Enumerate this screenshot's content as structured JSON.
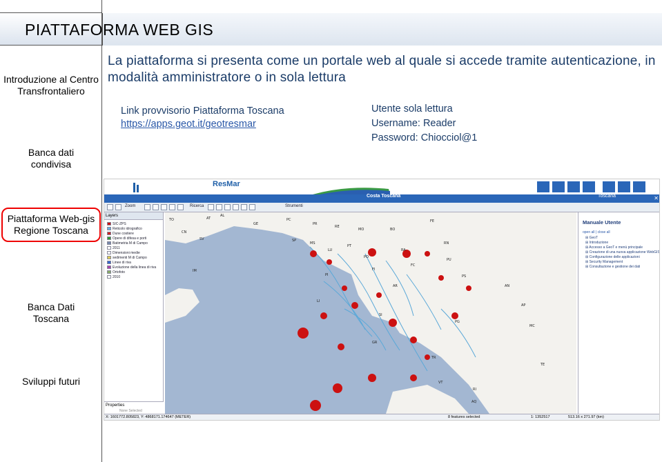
{
  "header": {
    "title": "PIATTAFORMA WEB GIS"
  },
  "nav": {
    "items": [
      {
        "label": "Introduzione al Centro Transfrontaliero",
        "active": false
      },
      {
        "label": "Banca dati condivisa",
        "active": false
      },
      {
        "label": "Piattaforma Web-gis Regione Toscana",
        "active": true
      },
      {
        "label": "Banca Dati Toscana",
        "active": false
      },
      {
        "label": "Sviluppi futuri",
        "active": false
      }
    ]
  },
  "content": {
    "intro": "La piattaforma si presenta come un portale web al quale si accede tramite autenticazione, in modalità amministratore o in sola lettura",
    "link_label": "Link provvisorio Piattaforma Toscana",
    "link_url": "https://apps.geot.it/geotresmar",
    "user_title": "Utente sola lettura",
    "username": "Username: Reader",
    "password": "Password: Chiocciol@1"
  },
  "screenshot": {
    "banner_title": "Costa Toscana",
    "banner_region": "Toscana",
    "resmar": "ResMar",
    "toolbar": {
      "zoom": "Zoom",
      "ricerca": "Ricerca",
      "strumenti": "Strumenti"
    },
    "layers_header": "Layers",
    "layers": [
      {
        "name": "SIC-ZPS",
        "color": "#cc1111"
      },
      {
        "name": "Reticolo idrografico",
        "color": "#6ab0e0"
      },
      {
        "name": "Dune costiere",
        "color": "#cc2222"
      },
      {
        "name": "Opere di difesa e porti",
        "color": "#339933"
      },
      {
        "name": "Batimetria M di Campo",
        "color": "#7788aa"
      },
      {
        "name": "2011",
        "color": "#ffffff"
      },
      {
        "name": "Dimensioni medie",
        "color": "#ffffff"
      },
      {
        "name": "sedimenti M di Campo",
        "color": "#ddcc55"
      },
      {
        "name": "Linee di riva",
        "color": "#3366cc"
      },
      {
        "name": "Evoluzione della linea di riva",
        "color": "#aa44aa"
      },
      {
        "name": "Ortofoto",
        "color": "#88aa66"
      },
      {
        "name": "2010",
        "color": "#ffffff"
      }
    ],
    "props_header": "Properties",
    "props_none": "None Selected",
    "status_left": "X: 1601772.805823, Y: 4868171.174647 (METER)",
    "status_mid": "8 features selected",
    "status_scale": "1: 1352517",
    "status_dim": "513.16 x 271.97 (km)",
    "help": {
      "title": "Manuale Utente",
      "links": "open all | close all",
      "items": [
        "GeoT",
        "Introduzione",
        "Accesso a GeoT e menù principale",
        "Creazione di una nuova applicazione WebGIS",
        "Configurazione delle applicazioni",
        "Security Management",
        "Consultazione e gestione dei dati"
      ]
    },
    "map_labels": [
      "AL",
      "GE",
      "PC",
      "PR",
      "RE",
      "MO",
      "BO",
      "FE",
      "SP",
      "MS",
      "LU",
      "PT",
      "FI",
      "PO",
      "RA",
      "FC",
      "RN",
      "AR",
      "SI",
      "GR",
      "PG",
      "VT",
      "TR",
      "RI",
      "AQ",
      "TE",
      "MC",
      "AP",
      "AN",
      "PS",
      "PU",
      "LI",
      "PI",
      "CN",
      "SV",
      "IM",
      "TO",
      "AT"
    ]
  }
}
